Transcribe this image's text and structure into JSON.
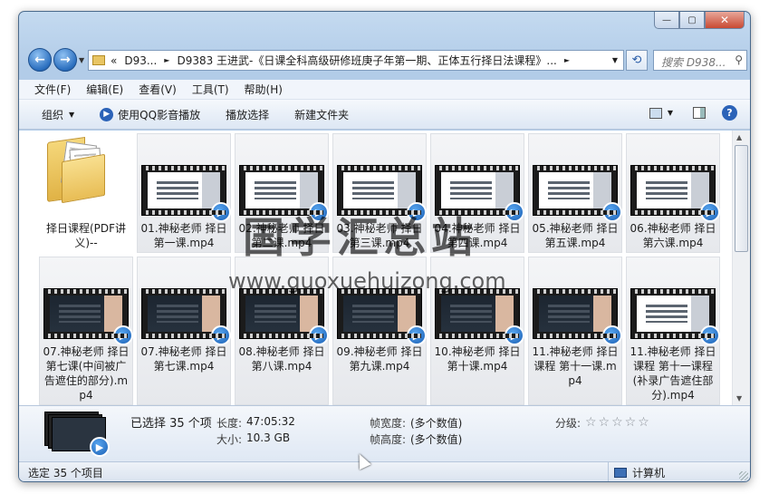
{
  "window": {
    "min_label": "—",
    "max_label": "▢",
    "close_label": "✕"
  },
  "nav": {
    "back_glyph": "←",
    "forward_glyph": "→",
    "history_glyph": "▼",
    "address": {
      "overflow": "«",
      "crumb1": "D93...",
      "crumb2": "D9383 王进武-《日课全科高级研修班庚子年第一期、正体五行择日法课程》...",
      "sep": "►"
    },
    "refresh_glyph": "⟲",
    "search_placeholder": "搜索 D938...",
    "search_glyph": "⚲"
  },
  "menu": {
    "items": [
      "文件(F)",
      "编辑(E)",
      "查看(V)",
      "工具(T)",
      "帮助(H)"
    ]
  },
  "toolbar": {
    "organize": "组织",
    "caret": "▼",
    "play_qq": "使用QQ影音播放",
    "play_selection": "播放选择",
    "new_folder": "新建文件夹",
    "help": "?"
  },
  "files": [
    {
      "label": "择日课程(PDF讲义)--",
      "kind": "folder"
    },
    {
      "label": "01.神秘老师 择日第一课.mp4",
      "kind": "video",
      "dark": false
    },
    {
      "label": "02.神秘老师 择日第二课.mp4",
      "kind": "video",
      "dark": false
    },
    {
      "label": "03.神秘老师 择日第三课.mp4",
      "kind": "video",
      "dark": false
    },
    {
      "label": "04.神秘老师 择日第四课.mp4",
      "kind": "video",
      "dark": false
    },
    {
      "label": "05.神秘老师 择日第五课.mp4",
      "kind": "video",
      "dark": false
    },
    {
      "label": "06.神秘老师 择日第六课.mp4",
      "kind": "video",
      "dark": false
    },
    {
      "label": "07.神秘老师 择日第七课(中间被广告遮住的部分).mp4",
      "kind": "video",
      "dark": true
    },
    {
      "label": "07.神秘老师 择日第七课.mp4",
      "kind": "video",
      "dark": true
    },
    {
      "label": "08.神秘老师 择日第八课.mp4",
      "kind": "video",
      "dark": true
    },
    {
      "label": "09.神秘老师 择日第九课.mp4",
      "kind": "video",
      "dark": true
    },
    {
      "label": "10.神秘老师 择日第十课.mp4",
      "kind": "video",
      "dark": true
    },
    {
      "label": "11.神秘老师 择日课程 第十一课.mp4",
      "kind": "video",
      "dark": true
    },
    {
      "label": "11.神秘老师 择日课程 第十一课程(补录广告遮住部分).mp4",
      "kind": "video",
      "dark": false
    }
  ],
  "watermark": {
    "title": "国学汇总站",
    "url": "www.guoxuehuizong.com"
  },
  "details": {
    "selected": "已选择 35 个项",
    "length_label": "长度:",
    "length_value": "47:05:32",
    "size_label": "大小:",
    "size_value": "10.3 GB",
    "frame_width_label": "帧宽度:",
    "frame_width_value": "(多个数值)",
    "frame_height_label": "帧高度:",
    "frame_height_value": "(多个数值)",
    "rating_label": "分级:",
    "rating_stars": "☆☆☆☆☆",
    "rating_value": 0
  },
  "status": {
    "left": "选定 35 个项目",
    "right": "计算机"
  },
  "colors": {
    "accent": "#2c63b8",
    "window_frame": "#b2cce8"
  }
}
